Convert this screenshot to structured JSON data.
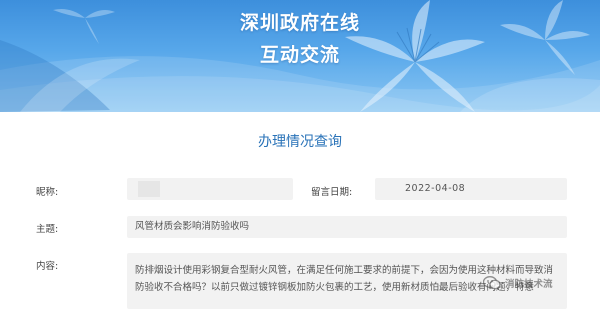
{
  "banner": {
    "title_line1": "深圳政府在线",
    "title_line2": "互动交流"
  },
  "section": {
    "title": "办理情况查询"
  },
  "form": {
    "name_label": "昵称:",
    "name_value": "",
    "date_label": "留言日期:",
    "date_value": "2022-04-08",
    "subject_label": "主题:",
    "subject_value": "风管材质会影响消防验收吗",
    "content_label": "内容:",
    "content_value": "防排烟设计使用彩钢复合型耐火风管，在满足任何施工要求的前提下，会因为使用这种材料而导致消防验收不合格吗？以前只做过镀锌钢板加防火包裹的工艺，使用新材质怕最后验收有问题，特意"
  },
  "watermark": {
    "text": "消防技术流",
    "icon": "wechat-icon"
  },
  "colors": {
    "banner_top": "#3d8fdc",
    "banner_bottom": "#8cc7f3",
    "section_title": "#2a73b8",
    "field_bg": "#f2f2f2"
  }
}
